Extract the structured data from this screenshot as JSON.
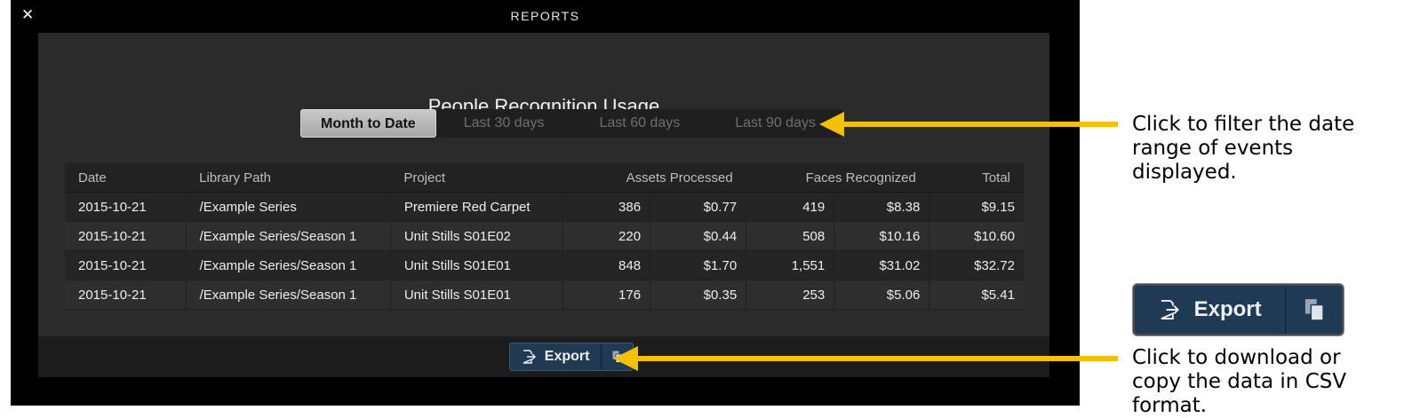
{
  "window": {
    "title": "REPORTS",
    "close_icon": "close-icon"
  },
  "panel": {
    "title": "People Recognition Usage",
    "ranges": [
      "Month to Date",
      "Last 30 days",
      "Last 60 days",
      "Last 90 days"
    ],
    "selected_range": "Month to Date"
  },
  "table": {
    "headers": {
      "date": "Date",
      "path": "Library Path",
      "project": "Project",
      "assets": "Assets Processed",
      "faces": "Faces Recognized",
      "total": "Total"
    },
    "rows": [
      {
        "date": "2015-10-21",
        "path": "/Example Series",
        "project": "Premiere Red Carpet",
        "assets": "386",
        "assets_cost": "$0.77",
        "faces": "419",
        "faces_cost": "$8.38",
        "total": "$9.15"
      },
      {
        "date": "2015-10-21",
        "path": "/Example Series/Season 1",
        "project": "Unit Stills S01E02",
        "assets": "220",
        "assets_cost": "$0.44",
        "faces": "508",
        "faces_cost": "$10.16",
        "total": "$10.60"
      },
      {
        "date": "2015-10-21",
        "path": "/Example Series/Season 1",
        "project": "Unit Stills S01E01",
        "assets": "848",
        "assets_cost": "$1.70",
        "faces": "1,551",
        "faces_cost": "$31.02",
        "total": "$32.72"
      },
      {
        "date": "2015-10-21",
        "path": "/Example Series/Season 1",
        "project": "Unit Stills S01E01",
        "assets": "176",
        "assets_cost": "$0.35",
        "faces": "253",
        "faces_cost": "$5.06",
        "total": "$5.41"
      }
    ]
  },
  "export": {
    "label": "Export",
    "export_icon": "export-icon",
    "copy_icon": "clipboard-icon",
    "color": "#1f3a52"
  },
  "callouts": {
    "filter": "Click to filter the date range of events displayed.",
    "export": "Click to download or copy the data in CSV format.",
    "arrow_color": "#f5c000"
  }
}
